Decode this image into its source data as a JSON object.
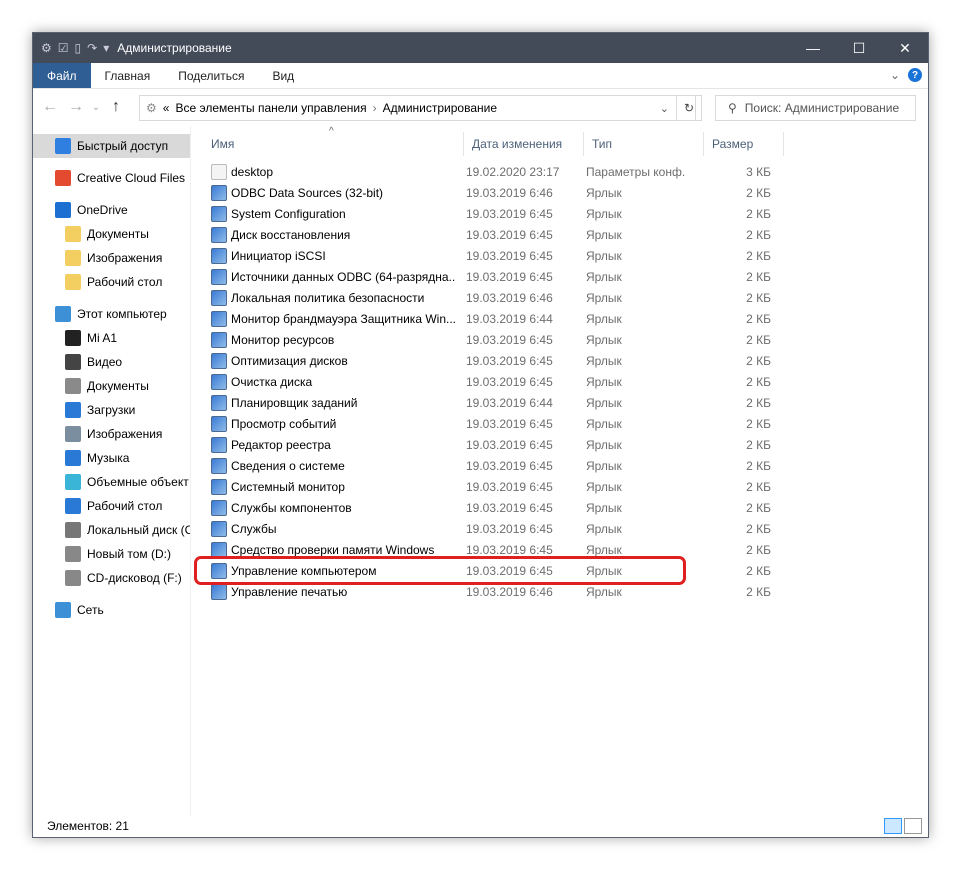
{
  "window": {
    "title": "Администрирование",
    "minimize": "—",
    "maximize": "☐",
    "close": "✕"
  },
  "ribbon": {
    "tabs": [
      "Файл",
      "Главная",
      "Поделиться",
      "Вид"
    ]
  },
  "address": {
    "overflow": "«",
    "crumbs": [
      "Все элементы панели управления",
      "Администрирование"
    ],
    "separator": "›"
  },
  "search": {
    "placeholder": "Поиск: Администрирование"
  },
  "sidebar": {
    "items": [
      {
        "label": "Быстрый доступ",
        "color": "#2f7fe0",
        "level": 0,
        "selected": true
      },
      {
        "label": "Creative Cloud Files",
        "color": "#e34a2f",
        "level": 0
      },
      {
        "label": "OneDrive",
        "color": "#1d6fd1",
        "level": 0
      },
      {
        "label": "Документы",
        "color": "#f3cf62",
        "level": 1
      },
      {
        "label": "Изображения",
        "color": "#f3cf62",
        "level": 1
      },
      {
        "label": "Рабочий стол",
        "color": "#f3cf62",
        "level": 1
      },
      {
        "label": "Этот компьютер",
        "color": "#3d8fd6",
        "level": 0
      },
      {
        "label": "Mi A1",
        "color": "#222222",
        "level": 1
      },
      {
        "label": "Видео",
        "color": "#444444",
        "level": 1
      },
      {
        "label": "Документы",
        "color": "#8a8a8a",
        "level": 1
      },
      {
        "label": "Загрузки",
        "color": "#2b79d6",
        "level": 1
      },
      {
        "label": "Изображения",
        "color": "#7a8ea0",
        "level": 1
      },
      {
        "label": "Музыка",
        "color": "#2b79d6",
        "level": 1
      },
      {
        "label": "Объемные объект",
        "color": "#3ab5d8",
        "level": 1
      },
      {
        "label": "Рабочий стол",
        "color": "#2b79d6",
        "level": 1
      },
      {
        "label": "Локальный диск (C",
        "color": "#777777",
        "level": 1
      },
      {
        "label": "Новый том (D:)",
        "color": "#888888",
        "level": 1
      },
      {
        "label": "CD-дисковод (F:)",
        "color": "#888888",
        "level": 1
      },
      {
        "label": "Сеть",
        "color": "#3d8fd6",
        "level": 0
      }
    ]
  },
  "columns": [
    "Имя",
    "Дата изменения",
    "Тип",
    "Размер"
  ],
  "files": [
    {
      "name": "desktop",
      "date": "19.02.2020 23:17",
      "type": "Параметры конф...",
      "size": "3 КБ",
      "icon": "settings-file"
    },
    {
      "name": "ODBC Data Sources (32-bit)",
      "date": "19.03.2019 6:46",
      "type": "Ярлык",
      "size": "2 КБ",
      "icon": "shortcut"
    },
    {
      "name": "System Configuration",
      "date": "19.03.2019 6:45",
      "type": "Ярлык",
      "size": "2 КБ",
      "icon": "shortcut"
    },
    {
      "name": "Диск восстановления",
      "date": "19.03.2019 6:45",
      "type": "Ярлык",
      "size": "2 КБ",
      "icon": "shortcut"
    },
    {
      "name": "Инициатор iSCSI",
      "date": "19.03.2019 6:45",
      "type": "Ярлык",
      "size": "2 КБ",
      "icon": "shortcut"
    },
    {
      "name": "Источники данных ODBC (64-разрядна...",
      "date": "19.03.2019 6:45",
      "type": "Ярлык",
      "size": "2 КБ",
      "icon": "shortcut"
    },
    {
      "name": "Локальная политика безопасности",
      "date": "19.03.2019 6:46",
      "type": "Ярлык",
      "size": "2 КБ",
      "icon": "shortcut"
    },
    {
      "name": "Монитор брандмауэра Защитника Win...",
      "date": "19.03.2019 6:44",
      "type": "Ярлык",
      "size": "2 КБ",
      "icon": "shortcut"
    },
    {
      "name": "Монитор ресурсов",
      "date": "19.03.2019 6:45",
      "type": "Ярлык",
      "size": "2 КБ",
      "icon": "shortcut"
    },
    {
      "name": "Оптимизация дисков",
      "date": "19.03.2019 6:45",
      "type": "Ярлык",
      "size": "2 КБ",
      "icon": "shortcut"
    },
    {
      "name": "Очистка диска",
      "date": "19.03.2019 6:45",
      "type": "Ярлык",
      "size": "2 КБ",
      "icon": "shortcut"
    },
    {
      "name": "Планировщик заданий",
      "date": "19.03.2019 6:44",
      "type": "Ярлык",
      "size": "2 КБ",
      "icon": "shortcut"
    },
    {
      "name": "Просмотр событий",
      "date": "19.03.2019 6:45",
      "type": "Ярлык",
      "size": "2 КБ",
      "icon": "shortcut"
    },
    {
      "name": "Редактор реестра",
      "date": "19.03.2019 6:45",
      "type": "Ярлык",
      "size": "2 КБ",
      "icon": "shortcut"
    },
    {
      "name": "Сведения о системе",
      "date": "19.03.2019 6:45",
      "type": "Ярлык",
      "size": "2 КБ",
      "icon": "shortcut"
    },
    {
      "name": "Системный монитор",
      "date": "19.03.2019 6:45",
      "type": "Ярлык",
      "size": "2 КБ",
      "icon": "shortcut"
    },
    {
      "name": "Службы компонентов",
      "date": "19.03.2019 6:45",
      "type": "Ярлык",
      "size": "2 КБ",
      "icon": "shortcut"
    },
    {
      "name": "Службы",
      "date": "19.03.2019 6:45",
      "type": "Ярлык",
      "size": "2 КБ",
      "icon": "shortcut"
    },
    {
      "name": "Средство проверки памяти Windows",
      "date": "19.03.2019 6:45",
      "type": "Ярлык",
      "size": "2 КБ",
      "icon": "shortcut"
    },
    {
      "name": "Управление компьютером",
      "date": "19.03.2019 6:45",
      "type": "Ярлык",
      "size": "2 КБ",
      "icon": "shortcut",
      "highlighted": true
    },
    {
      "name": "Управление печатью",
      "date": "19.03.2019 6:46",
      "type": "Ярлык",
      "size": "2 КБ",
      "icon": "shortcut"
    }
  ],
  "status": {
    "text": "Элементов: 21"
  },
  "colors": {
    "titlebar": "#434b59",
    "file_tab": "#2e5e93",
    "highlight": "#e02020"
  }
}
